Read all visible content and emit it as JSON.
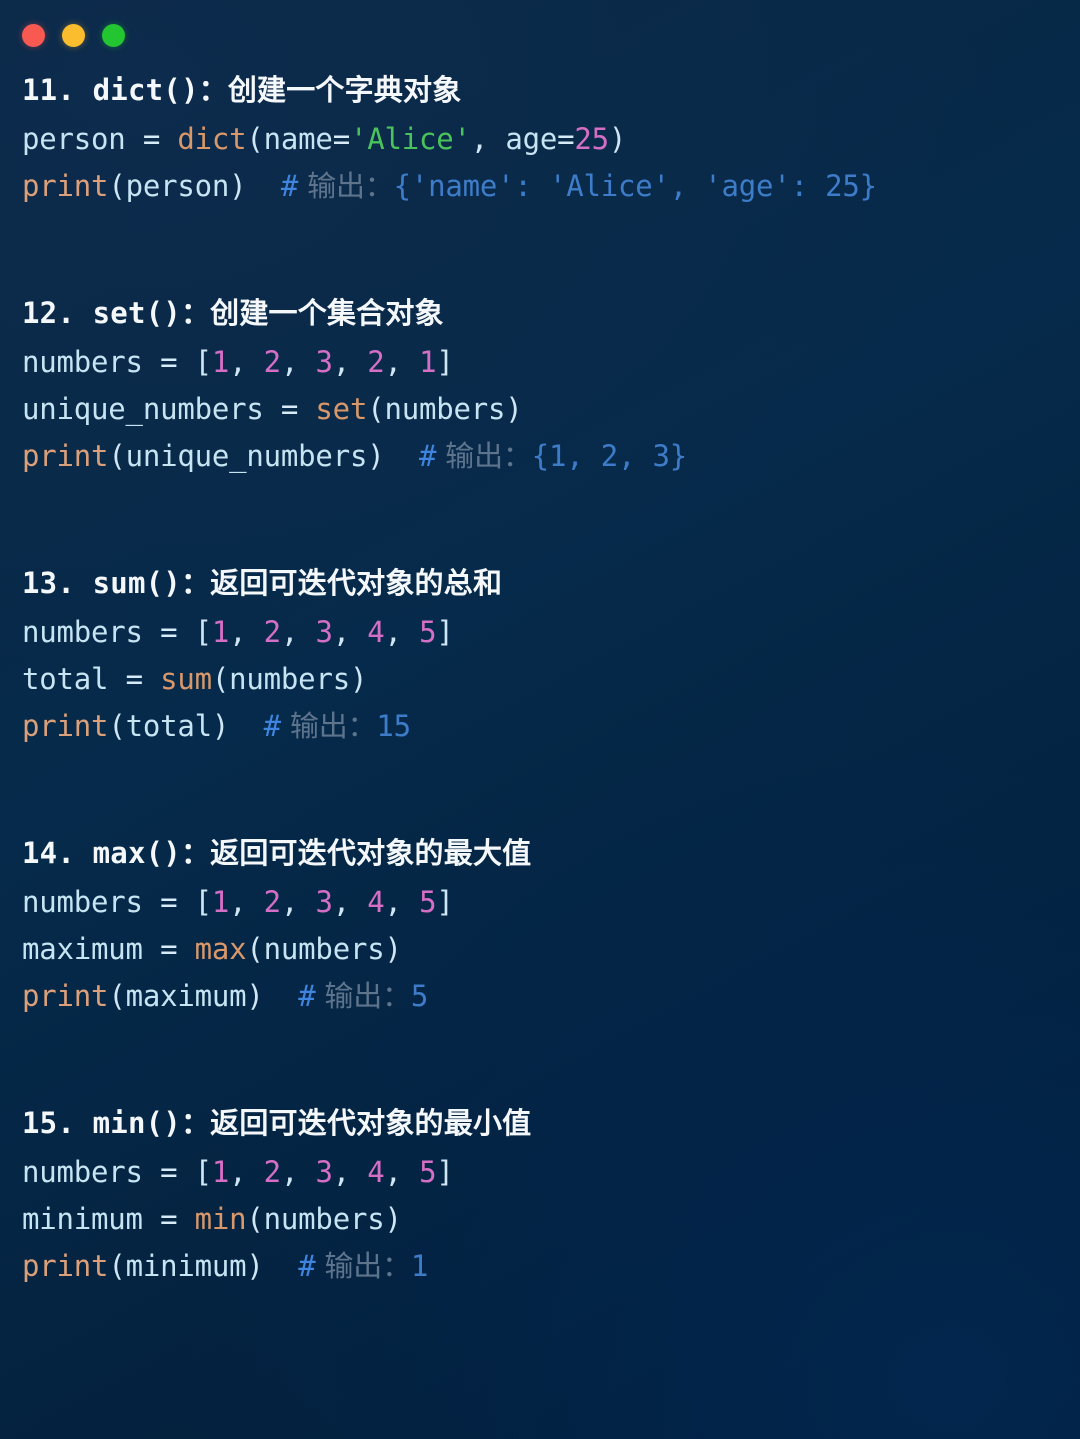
{
  "window": {
    "controls": [
      {
        "name": "close",
        "color": "#f85a52"
      },
      {
        "name": "minimize",
        "color": "#fbbd2d"
      },
      {
        "name": "maximize",
        "color": "#23c531"
      }
    ]
  },
  "theme": {
    "background": "#062a4b",
    "variable": "#c6e4f2",
    "builtin": "#d9986a",
    "print": "#dba07a",
    "string": "#4ac45a",
    "number": "#d46fc5",
    "comment_hash": "#3f85e0",
    "comment_text": "#5d748c",
    "comment_output": "#3d7cc9",
    "heading": "#f4f8fb"
  },
  "sections": [
    {
      "index": "11.",
      "func": " dict()",
      "colon": "：",
      "desc": "创建一个字典对象",
      "lines": [
        [
          {
            "t": "person",
            "c": "t-var"
          },
          {
            "t": " = ",
            "c": "t-op"
          },
          {
            "t": "dict",
            "c": "t-fn"
          },
          {
            "t": "(",
            "c": "t-punc"
          },
          {
            "t": "name",
            "c": "t-var"
          },
          {
            "t": "=",
            "c": "t-op"
          },
          {
            "t": "'Alice'",
            "c": "t-str"
          },
          {
            "t": ", ",
            "c": "t-punc"
          },
          {
            "t": "age",
            "c": "t-var"
          },
          {
            "t": "=",
            "c": "t-op"
          },
          {
            "t": "25",
            "c": "t-num"
          },
          {
            "t": ")",
            "c": "t-punc"
          }
        ],
        [
          {
            "t": "print",
            "c": "t-print"
          },
          {
            "t": "(",
            "c": "t-punc"
          },
          {
            "t": "person",
            "c": "t-var"
          },
          {
            "t": ")  ",
            "c": "t-punc"
          },
          {
            "t": "#",
            "c": "t-hash"
          },
          {
            "t": " 输出：",
            "c": "t-cmt t-cn"
          },
          {
            "t": "{'name': 'Alice', 'age': 25}",
            "c": "t-out"
          }
        ]
      ]
    },
    {
      "index": "12.",
      "func": " set()",
      "colon": "：",
      "desc": "创建一个集合对象",
      "lines": [
        [
          {
            "t": "numbers",
            "c": "t-var"
          },
          {
            "t": " = ",
            "c": "t-op"
          },
          {
            "t": "[",
            "c": "t-punc"
          },
          {
            "t": "1",
            "c": "t-num"
          },
          {
            "t": ", ",
            "c": "t-punc"
          },
          {
            "t": "2",
            "c": "t-num"
          },
          {
            "t": ", ",
            "c": "t-punc"
          },
          {
            "t": "3",
            "c": "t-num"
          },
          {
            "t": ", ",
            "c": "t-punc"
          },
          {
            "t": "2",
            "c": "t-num"
          },
          {
            "t": ", ",
            "c": "t-punc"
          },
          {
            "t": "1",
            "c": "t-num"
          },
          {
            "t": "]",
            "c": "t-punc"
          }
        ],
        [
          {
            "t": "unique_numbers",
            "c": "t-var"
          },
          {
            "t": " = ",
            "c": "t-op"
          },
          {
            "t": "set",
            "c": "t-fn"
          },
          {
            "t": "(",
            "c": "t-punc"
          },
          {
            "t": "numbers",
            "c": "t-var"
          },
          {
            "t": ")",
            "c": "t-punc"
          }
        ],
        [
          {
            "t": "print",
            "c": "t-print"
          },
          {
            "t": "(",
            "c": "t-punc"
          },
          {
            "t": "unique_numbers",
            "c": "t-var"
          },
          {
            "t": ")  ",
            "c": "t-punc"
          },
          {
            "t": "#",
            "c": "t-hash"
          },
          {
            "t": " 输出：",
            "c": "t-cmt t-cn"
          },
          {
            "t": "{1, 2, 3}",
            "c": "t-out"
          }
        ]
      ]
    },
    {
      "index": "13.",
      "func": " sum()",
      "colon": "：",
      "desc": "返回可迭代对象的总和",
      "lines": [
        [
          {
            "t": "numbers",
            "c": "t-var"
          },
          {
            "t": " = ",
            "c": "t-op"
          },
          {
            "t": "[",
            "c": "t-punc"
          },
          {
            "t": "1",
            "c": "t-num"
          },
          {
            "t": ", ",
            "c": "t-punc"
          },
          {
            "t": "2",
            "c": "t-num"
          },
          {
            "t": ", ",
            "c": "t-punc"
          },
          {
            "t": "3",
            "c": "t-num"
          },
          {
            "t": ", ",
            "c": "t-punc"
          },
          {
            "t": "4",
            "c": "t-num"
          },
          {
            "t": ", ",
            "c": "t-punc"
          },
          {
            "t": "5",
            "c": "t-num"
          },
          {
            "t": "]",
            "c": "t-punc"
          }
        ],
        [
          {
            "t": "total",
            "c": "t-var"
          },
          {
            "t": " = ",
            "c": "t-op"
          },
          {
            "t": "sum",
            "c": "t-fn"
          },
          {
            "t": "(",
            "c": "t-punc"
          },
          {
            "t": "numbers",
            "c": "t-var"
          },
          {
            "t": ")",
            "c": "t-punc"
          }
        ],
        [
          {
            "t": "print",
            "c": "t-print"
          },
          {
            "t": "(",
            "c": "t-punc"
          },
          {
            "t": "total",
            "c": "t-var"
          },
          {
            "t": ")  ",
            "c": "t-punc"
          },
          {
            "t": "#",
            "c": "t-hash"
          },
          {
            "t": " 输出：",
            "c": "t-cmt t-cn"
          },
          {
            "t": "15",
            "c": "t-out"
          }
        ]
      ]
    },
    {
      "index": "14.",
      "func": " max()",
      "colon": "：",
      "desc": "返回可迭代对象的最大值",
      "lines": [
        [
          {
            "t": "numbers",
            "c": "t-var"
          },
          {
            "t": " = ",
            "c": "t-op"
          },
          {
            "t": "[",
            "c": "t-punc"
          },
          {
            "t": "1",
            "c": "t-num"
          },
          {
            "t": ", ",
            "c": "t-punc"
          },
          {
            "t": "2",
            "c": "t-num"
          },
          {
            "t": ", ",
            "c": "t-punc"
          },
          {
            "t": "3",
            "c": "t-num"
          },
          {
            "t": ", ",
            "c": "t-punc"
          },
          {
            "t": "4",
            "c": "t-num"
          },
          {
            "t": ", ",
            "c": "t-punc"
          },
          {
            "t": "5",
            "c": "t-num"
          },
          {
            "t": "]",
            "c": "t-punc"
          }
        ],
        [
          {
            "t": "maximum",
            "c": "t-var"
          },
          {
            "t": " = ",
            "c": "t-op"
          },
          {
            "t": "max",
            "c": "t-fn"
          },
          {
            "t": "(",
            "c": "t-punc"
          },
          {
            "t": "numbers",
            "c": "t-var"
          },
          {
            "t": ")",
            "c": "t-punc"
          }
        ],
        [
          {
            "t": "print",
            "c": "t-print"
          },
          {
            "t": "(",
            "c": "t-punc"
          },
          {
            "t": "maximum",
            "c": "t-var"
          },
          {
            "t": ")  ",
            "c": "t-punc"
          },
          {
            "t": "#",
            "c": "t-hash"
          },
          {
            "t": " 输出：",
            "c": "t-cmt t-cn"
          },
          {
            "t": "5",
            "c": "t-out"
          }
        ]
      ]
    },
    {
      "index": "15.",
      "func": " min()",
      "colon": "：",
      "desc": "返回可迭代对象的最小值",
      "lines": [
        [
          {
            "t": "numbers",
            "c": "t-var"
          },
          {
            "t": " = ",
            "c": "t-op"
          },
          {
            "t": "[",
            "c": "t-punc"
          },
          {
            "t": "1",
            "c": "t-num"
          },
          {
            "t": ", ",
            "c": "t-punc"
          },
          {
            "t": "2",
            "c": "t-num"
          },
          {
            "t": ", ",
            "c": "t-punc"
          },
          {
            "t": "3",
            "c": "t-num"
          },
          {
            "t": ", ",
            "c": "t-punc"
          },
          {
            "t": "4",
            "c": "t-num"
          },
          {
            "t": ", ",
            "c": "t-punc"
          },
          {
            "t": "5",
            "c": "t-num"
          },
          {
            "t": "]",
            "c": "t-punc"
          }
        ],
        [
          {
            "t": "minimum",
            "c": "t-var"
          },
          {
            "t": " = ",
            "c": "t-op"
          },
          {
            "t": "min",
            "c": "t-fn"
          },
          {
            "t": "(",
            "c": "t-punc"
          },
          {
            "t": "numbers",
            "c": "t-var"
          },
          {
            "t": ")",
            "c": "t-punc"
          }
        ],
        [
          {
            "t": "print",
            "c": "t-print"
          },
          {
            "t": "(",
            "c": "t-punc"
          },
          {
            "t": "minimum",
            "c": "t-var"
          },
          {
            "t": ")  ",
            "c": "t-punc"
          },
          {
            "t": "#",
            "c": "t-hash"
          },
          {
            "t": " 输出：",
            "c": "t-cmt t-cn"
          },
          {
            "t": "1",
            "c": "t-out"
          }
        ]
      ]
    }
  ]
}
